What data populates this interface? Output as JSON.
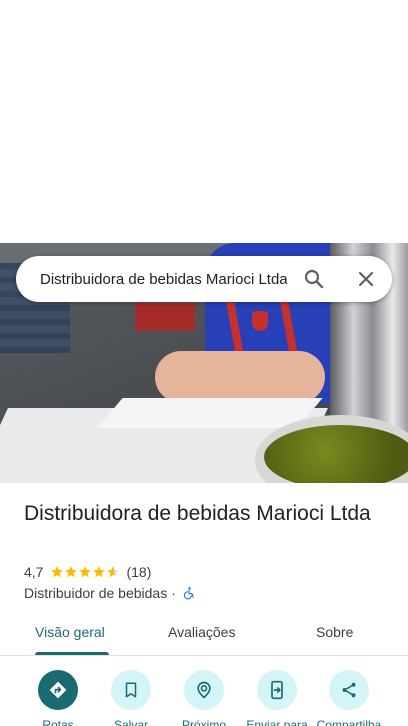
{
  "search": {
    "value": "Distribuidora de bebidas Marioci Ltda"
  },
  "place": {
    "title": "Distribuidora de bebidas Marioci Ltda",
    "rating": "4,7",
    "stars": 4.7,
    "review_count": "(18)",
    "category": "Distribuidor de bebidas",
    "separator": "·"
  },
  "tabs": [
    {
      "label": "Visão geral",
      "active": true
    },
    {
      "label": "Avaliações",
      "active": false
    },
    {
      "label": "Sobre",
      "active": false
    }
  ],
  "actions": [
    {
      "label": "Rotas",
      "icon": "directions-icon"
    },
    {
      "label": "Salvar",
      "icon": "bookmark-icon"
    },
    {
      "label": "Próximo",
      "icon": "nearby-icon"
    },
    {
      "label": "Enviar para",
      "icon": "send-to-phone-icon"
    },
    {
      "label": "Compartilha",
      "icon": "share-icon"
    }
  ],
  "colors": {
    "accent": "#1a6b71",
    "action_bg": "#d4f5f8",
    "star": "#fbbc04",
    "wheelchair": "#1a73e8"
  }
}
